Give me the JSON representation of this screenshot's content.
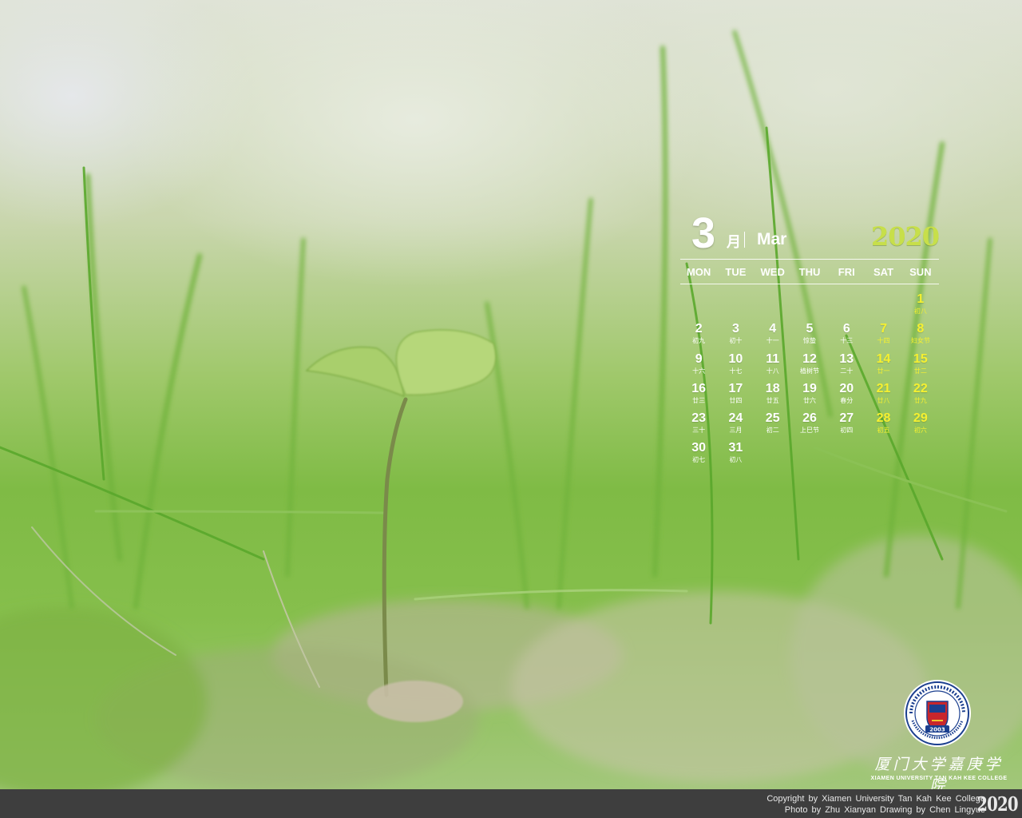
{
  "calendar": {
    "month_number": "3",
    "month_cn": "月",
    "month_en": "Mar",
    "year": "2020",
    "weekdays": [
      "MON",
      "TUE",
      "WED",
      "THU",
      "FRI",
      "SAT",
      "SUN"
    ],
    "weeks": [
      [
        null,
        null,
        null,
        null,
        null,
        null,
        {
          "d": "1",
          "l": "初八"
        }
      ],
      [
        {
          "d": "2",
          "l": "初九"
        },
        {
          "d": "3",
          "l": "初十"
        },
        {
          "d": "4",
          "l": "十一"
        },
        {
          "d": "5",
          "l": "惊蛰"
        },
        {
          "d": "6",
          "l": "十三"
        },
        {
          "d": "7",
          "l": "十四"
        },
        {
          "d": "8",
          "l": "妇女节"
        }
      ],
      [
        {
          "d": "9",
          "l": "十六"
        },
        {
          "d": "10",
          "l": "十七"
        },
        {
          "d": "11",
          "l": "十八"
        },
        {
          "d": "12",
          "l": "植树节"
        },
        {
          "d": "13",
          "l": "二十"
        },
        {
          "d": "14",
          "l": "廿一"
        },
        {
          "d": "15",
          "l": "廿二"
        }
      ],
      [
        {
          "d": "16",
          "l": "廿三"
        },
        {
          "d": "17",
          "l": "廿四"
        },
        {
          "d": "18",
          "l": "廿五"
        },
        {
          "d": "19",
          "l": "廿六"
        },
        {
          "d": "20",
          "l": "春分"
        },
        {
          "d": "21",
          "l": "廿八"
        },
        {
          "d": "22",
          "l": "廿九"
        }
      ],
      [
        {
          "d": "23",
          "l": "三十"
        },
        {
          "d": "24",
          "l": "三月"
        },
        {
          "d": "25",
          "l": "初二"
        },
        {
          "d": "26",
          "l": "上巳节"
        },
        {
          "d": "27",
          "l": "初四"
        },
        {
          "d": "28",
          "l": "初五"
        },
        {
          "d": "29",
          "l": "初六"
        }
      ],
      [
        {
          "d": "30",
          "l": "初七"
        },
        {
          "d": "31",
          "l": "初八"
        },
        null,
        null,
        null,
        null,
        null
      ]
    ],
    "weekend_color": "#f5f030",
    "year_color": "#c7df4a"
  },
  "branding": {
    "logo_icon": "college-seal-icon",
    "logo_year": "2003",
    "cn_name": "厦门大学嘉庚学院",
    "en_name": "XIAMEN UNIVERSITY TAN KAH KEE COLLEGE"
  },
  "footer": {
    "copyright": "Copyright by Xiamen University Tan Kah Kee College",
    "credits": "Photo by Zhu Xianyan Drawing by Chen Lingyue",
    "year": "2020"
  }
}
